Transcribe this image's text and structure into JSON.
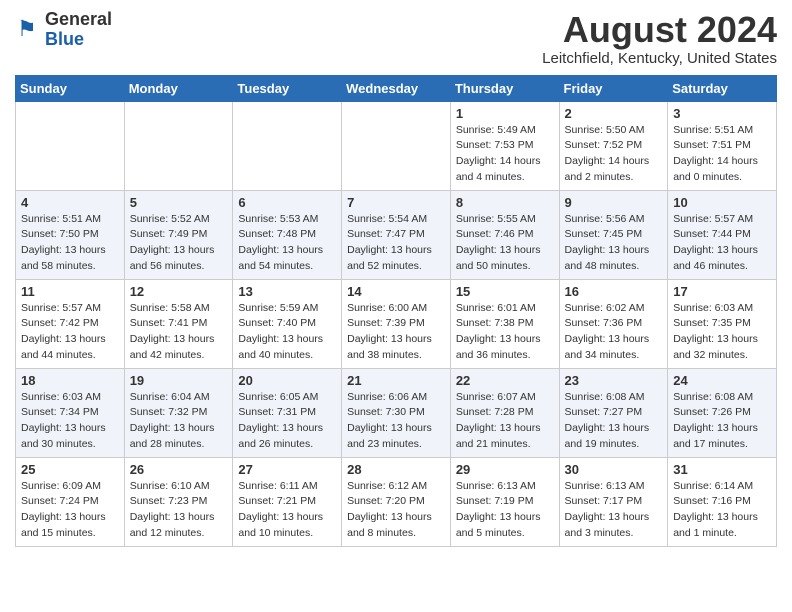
{
  "header": {
    "logo_line1": "General",
    "logo_line2": "Blue",
    "month_title": "August 2024",
    "location": "Leitchfield, Kentucky, United States"
  },
  "weekdays": [
    "Sunday",
    "Monday",
    "Tuesday",
    "Wednesday",
    "Thursday",
    "Friday",
    "Saturday"
  ],
  "weeks": [
    [
      {
        "day": "",
        "info": ""
      },
      {
        "day": "",
        "info": ""
      },
      {
        "day": "",
        "info": ""
      },
      {
        "day": "",
        "info": ""
      },
      {
        "day": "1",
        "info": "Sunrise: 5:49 AM\nSunset: 7:53 PM\nDaylight: 14 hours\nand 4 minutes."
      },
      {
        "day": "2",
        "info": "Sunrise: 5:50 AM\nSunset: 7:52 PM\nDaylight: 14 hours\nand 2 minutes."
      },
      {
        "day": "3",
        "info": "Sunrise: 5:51 AM\nSunset: 7:51 PM\nDaylight: 14 hours\nand 0 minutes."
      }
    ],
    [
      {
        "day": "4",
        "info": "Sunrise: 5:51 AM\nSunset: 7:50 PM\nDaylight: 13 hours\nand 58 minutes."
      },
      {
        "day": "5",
        "info": "Sunrise: 5:52 AM\nSunset: 7:49 PM\nDaylight: 13 hours\nand 56 minutes."
      },
      {
        "day": "6",
        "info": "Sunrise: 5:53 AM\nSunset: 7:48 PM\nDaylight: 13 hours\nand 54 minutes."
      },
      {
        "day": "7",
        "info": "Sunrise: 5:54 AM\nSunset: 7:47 PM\nDaylight: 13 hours\nand 52 minutes."
      },
      {
        "day": "8",
        "info": "Sunrise: 5:55 AM\nSunset: 7:46 PM\nDaylight: 13 hours\nand 50 minutes."
      },
      {
        "day": "9",
        "info": "Sunrise: 5:56 AM\nSunset: 7:45 PM\nDaylight: 13 hours\nand 48 minutes."
      },
      {
        "day": "10",
        "info": "Sunrise: 5:57 AM\nSunset: 7:44 PM\nDaylight: 13 hours\nand 46 minutes."
      }
    ],
    [
      {
        "day": "11",
        "info": "Sunrise: 5:57 AM\nSunset: 7:42 PM\nDaylight: 13 hours\nand 44 minutes."
      },
      {
        "day": "12",
        "info": "Sunrise: 5:58 AM\nSunset: 7:41 PM\nDaylight: 13 hours\nand 42 minutes."
      },
      {
        "day": "13",
        "info": "Sunrise: 5:59 AM\nSunset: 7:40 PM\nDaylight: 13 hours\nand 40 minutes."
      },
      {
        "day": "14",
        "info": "Sunrise: 6:00 AM\nSunset: 7:39 PM\nDaylight: 13 hours\nand 38 minutes."
      },
      {
        "day": "15",
        "info": "Sunrise: 6:01 AM\nSunset: 7:38 PM\nDaylight: 13 hours\nand 36 minutes."
      },
      {
        "day": "16",
        "info": "Sunrise: 6:02 AM\nSunset: 7:36 PM\nDaylight: 13 hours\nand 34 minutes."
      },
      {
        "day": "17",
        "info": "Sunrise: 6:03 AM\nSunset: 7:35 PM\nDaylight: 13 hours\nand 32 minutes."
      }
    ],
    [
      {
        "day": "18",
        "info": "Sunrise: 6:03 AM\nSunset: 7:34 PM\nDaylight: 13 hours\nand 30 minutes."
      },
      {
        "day": "19",
        "info": "Sunrise: 6:04 AM\nSunset: 7:32 PM\nDaylight: 13 hours\nand 28 minutes."
      },
      {
        "day": "20",
        "info": "Sunrise: 6:05 AM\nSunset: 7:31 PM\nDaylight: 13 hours\nand 26 minutes."
      },
      {
        "day": "21",
        "info": "Sunrise: 6:06 AM\nSunset: 7:30 PM\nDaylight: 13 hours\nand 23 minutes."
      },
      {
        "day": "22",
        "info": "Sunrise: 6:07 AM\nSunset: 7:28 PM\nDaylight: 13 hours\nand 21 minutes."
      },
      {
        "day": "23",
        "info": "Sunrise: 6:08 AM\nSunset: 7:27 PM\nDaylight: 13 hours\nand 19 minutes."
      },
      {
        "day": "24",
        "info": "Sunrise: 6:08 AM\nSunset: 7:26 PM\nDaylight: 13 hours\nand 17 minutes."
      }
    ],
    [
      {
        "day": "25",
        "info": "Sunrise: 6:09 AM\nSunset: 7:24 PM\nDaylight: 13 hours\nand 15 minutes."
      },
      {
        "day": "26",
        "info": "Sunrise: 6:10 AM\nSunset: 7:23 PM\nDaylight: 13 hours\nand 12 minutes."
      },
      {
        "day": "27",
        "info": "Sunrise: 6:11 AM\nSunset: 7:21 PM\nDaylight: 13 hours\nand 10 minutes."
      },
      {
        "day": "28",
        "info": "Sunrise: 6:12 AM\nSunset: 7:20 PM\nDaylight: 13 hours\nand 8 minutes."
      },
      {
        "day": "29",
        "info": "Sunrise: 6:13 AM\nSunset: 7:19 PM\nDaylight: 13 hours\nand 5 minutes."
      },
      {
        "day": "30",
        "info": "Sunrise: 6:13 AM\nSunset: 7:17 PM\nDaylight: 13 hours\nand 3 minutes."
      },
      {
        "day": "31",
        "info": "Sunrise: 6:14 AM\nSunset: 7:16 PM\nDaylight: 13 hours\nand 1 minute."
      }
    ]
  ]
}
